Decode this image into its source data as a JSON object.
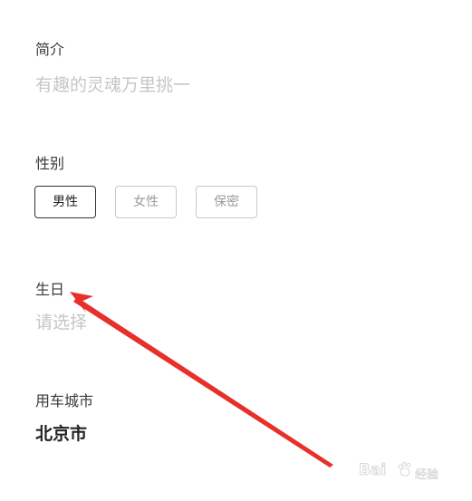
{
  "intro": {
    "label": "简介",
    "placeholder": "有趣的灵魂万里挑一"
  },
  "gender": {
    "label": "性别",
    "options": [
      {
        "label": "男性",
        "selected": true
      },
      {
        "label": "女性",
        "selected": false
      },
      {
        "label": "保密",
        "selected": false
      }
    ]
  },
  "birthday": {
    "label": "生日",
    "placeholder": "请选择"
  },
  "city": {
    "label": "用车城市",
    "value": "北京市"
  },
  "annotation": {
    "arrow_color": "#e8302a"
  },
  "watermark": {
    "brand": "Bai",
    "brand_suffix": "du",
    "sub": "经验"
  },
  "colors": {
    "label": "#3a3a3a",
    "placeholder": "#c6c6c6",
    "value": "#222222",
    "selected_border": "#333333",
    "unselected_border": "#c9c9c9"
  }
}
